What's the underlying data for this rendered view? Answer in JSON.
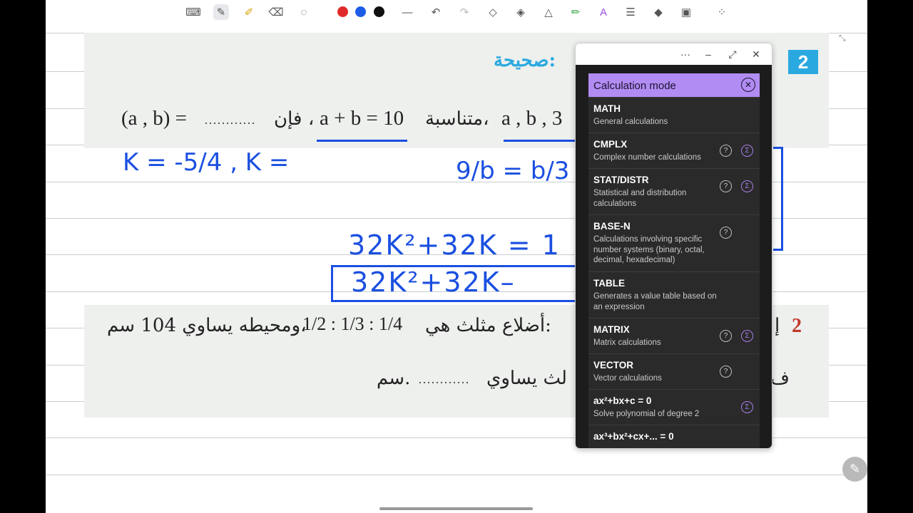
{
  "toolbar": {
    "tools": [
      "keyboard-icon",
      "pen-icon",
      "highlighter-icon",
      "eraser-icon",
      "lasso-icon"
    ],
    "colors": [
      "#e02a2a",
      "#1d5ce6",
      "#111111"
    ],
    "actions": [
      "line-thickness-icon",
      "undo-icon",
      "redo-icon",
      "shape-icon",
      "tape-icon",
      "laser-icon",
      "pencil-color-icon",
      "text-icon",
      "text-box-icon",
      "sticker-icon",
      "lock-icon",
      "more-icon"
    ]
  },
  "textbook": {
    "q1_badge": "2",
    "q1_heading_fragment": "صحيحة:",
    "q1_line_lat_left": "(a , b) =",
    "q1_line_dots": "…………",
    "q1_line_ar_1": "فإن",
    "q1_line_ar_comma": "،",
    "q1_line_lat_mid": "a + b = 10",
    "q1_line_ar_2": "متناسبة،",
    "q1_line_lat_right": "a , b , 3",
    "q2_number": "2",
    "q2_line1_ar_a": "إ",
    "q2_line1_ar_b": "أضلاع مثلث هي:",
    "q2_fractions": "1/2 : 1/3 : 1/4",
    "q2_line1_ar_c": "ومحيطه يساوي 104 سم،",
    "q2_line2_ar_a": "ف",
    "q2_line2_ar_b": "لث يساوي",
    "q2_line2_dots": "…………",
    "q2_line2_unit": "سم."
  },
  "handwriting": {
    "h1": "K = -5/4 , K =",
    "h2": "9/b = b/3",
    "h3": "32K²+32K = 1",
    "h4": "32K²+32K–"
  },
  "calculator": {
    "window_more": "···",
    "window_minimize": "–",
    "window_expand": "⤢",
    "window_close": "✕",
    "panel_title": "Calculation mode",
    "modes": [
      {
        "title": "MATH",
        "desc": "General calculations",
        "help": false,
        "sigma": false
      },
      {
        "title": "CMPLX",
        "desc": "Complex number calculations",
        "help": true,
        "sigma": true
      },
      {
        "title": "STAT/DISTR",
        "desc": "Statistical and distribution calculations",
        "help": true,
        "sigma": true
      },
      {
        "title": "BASE-N",
        "desc": "Calculations involving specific number systems (binary, octal, decimal, hexadecimal)",
        "help": true,
        "sigma": false
      },
      {
        "title": "TABLE",
        "desc": "Generates a value table based on an expression",
        "help": false,
        "sigma": false
      },
      {
        "title": "MATRIX",
        "desc": "Matrix calculations",
        "help": true,
        "sigma": true
      },
      {
        "title": "VECTOR",
        "desc": "Vector calculations",
        "help": true,
        "sigma": false
      },
      {
        "title": "ax²+bx+c = 0",
        "desc": "Solve polynomial of degree 2",
        "help": false,
        "sigma": true
      },
      {
        "title": "ax³+bx²+cx+... = 0",
        "desc": "",
        "help": false,
        "sigma": false
      }
    ]
  }
}
